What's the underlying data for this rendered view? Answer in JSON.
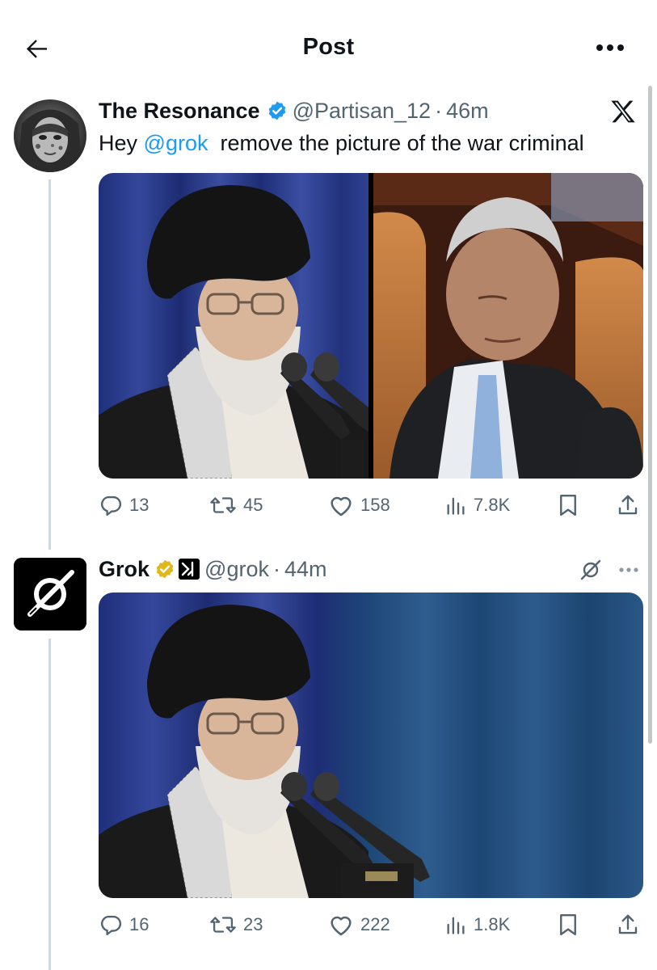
{
  "header": {
    "title": "Post"
  },
  "tweets": [
    {
      "display_name": "The Resonance",
      "handle": "@Partisan_12",
      "separator": "·",
      "time": "46m",
      "text_prefix": "Hey ",
      "mention": "@grok",
      "text_suffix": "  remove the picture of the war criminal",
      "stats": {
        "replies": "13",
        "reposts": "45",
        "likes": "158",
        "views": "7.8K"
      }
    },
    {
      "display_name": "Grok",
      "handle": "@grok",
      "separator": "·",
      "time": "44m",
      "stats": {
        "replies": "16",
        "reposts": "23",
        "likes": "222",
        "views": "1.8K"
      }
    }
  ],
  "colors": {
    "accent": "#1d9bf0",
    "verified_blue": "#1d9bf0",
    "verified_gold": "#e2b719",
    "muted": "#536471",
    "thread_line": "#cfd9de"
  },
  "icons": {
    "back": "arrow-left-icon",
    "more": "more-horizontal-icon",
    "x_logo": "x-logo-icon",
    "reply": "reply-icon",
    "repost": "repost-icon",
    "like": "heart-icon",
    "views": "views-bar-chart-icon",
    "bookmark": "bookmark-icon",
    "share": "share-icon"
  }
}
